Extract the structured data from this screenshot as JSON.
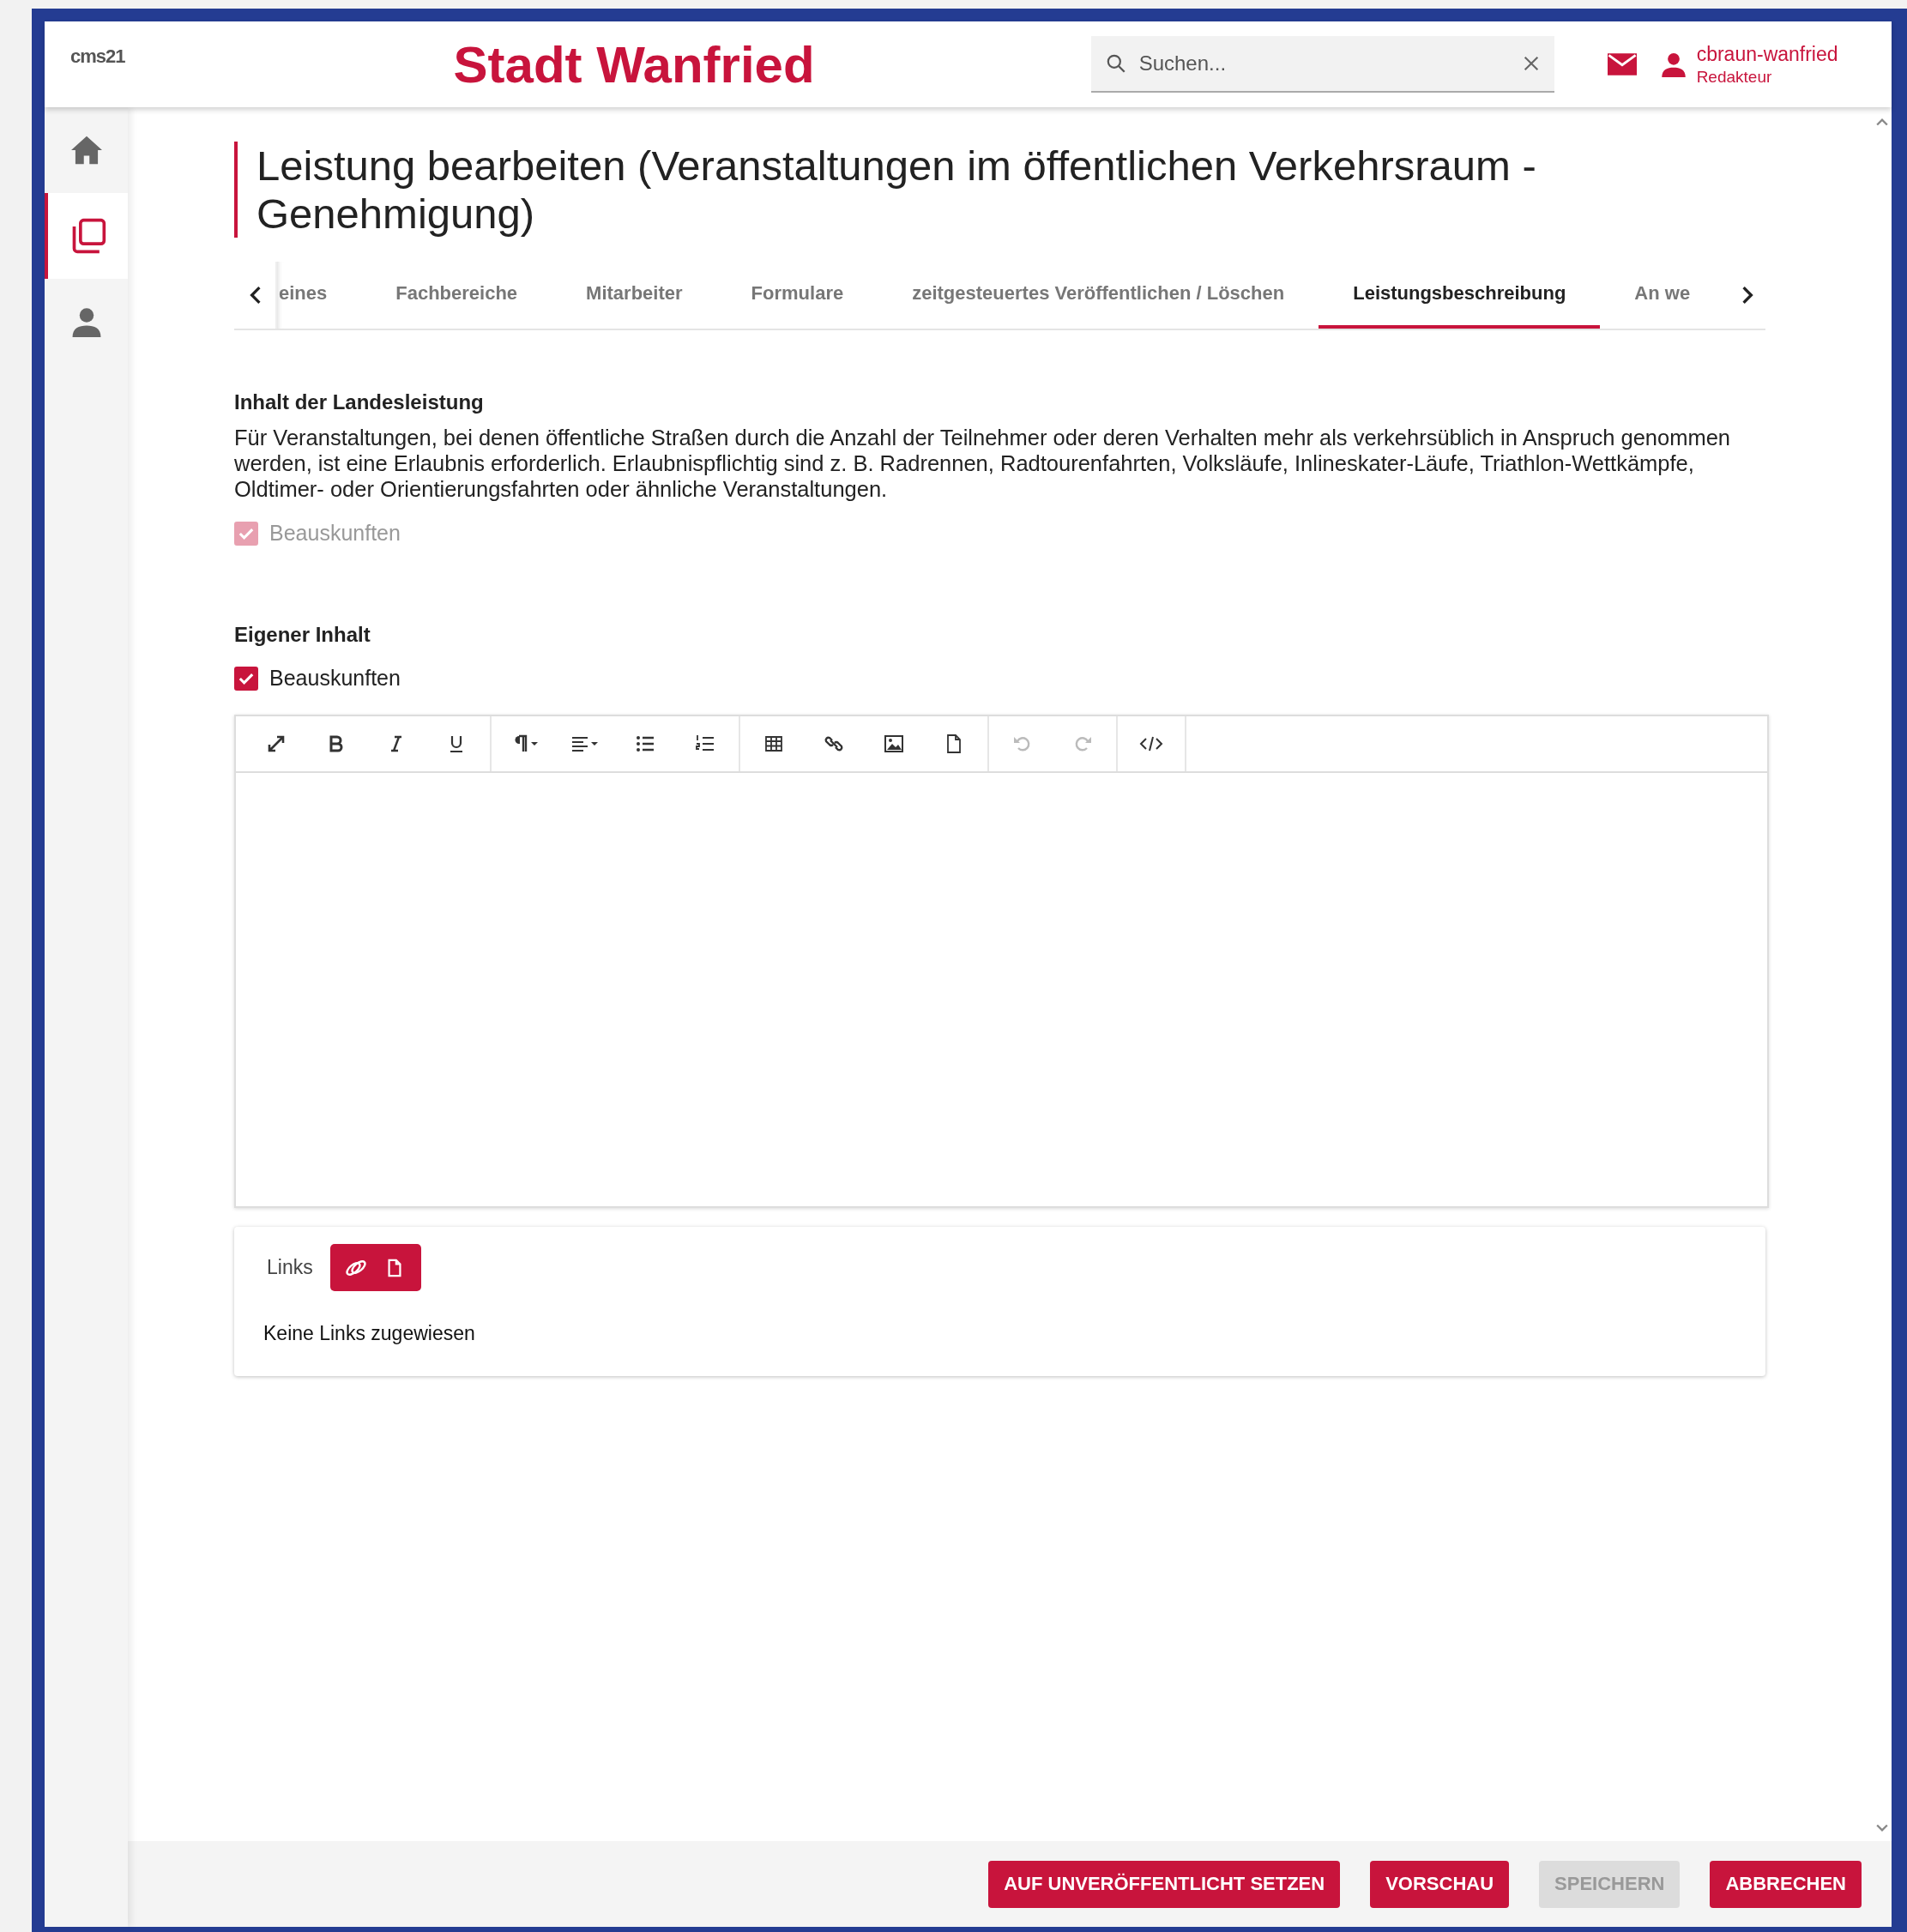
{
  "header": {
    "logo": "cms21",
    "site_title": "Stadt Wanfried",
    "search": {
      "placeholder": "Suchen..."
    },
    "user": {
      "name": "cbraun-wanfried",
      "role": "Redakteur"
    }
  },
  "sidebar": {
    "items": [
      {
        "kind": "home",
        "selected": false
      },
      {
        "kind": "pages",
        "selected": true
      },
      {
        "kind": "person",
        "selected": false
      }
    ]
  },
  "page_title": "Leistung bearbeiten (Veranstaltungen im öffentlichen Verkehrsraum - Genehmigung)",
  "tabs": [
    {
      "label": "eines",
      "selected": false
    },
    {
      "label": "Fachbereiche",
      "selected": false
    },
    {
      "label": "Mitarbeiter",
      "selected": false
    },
    {
      "label": "Formulare",
      "selected": false
    },
    {
      "label": "zeitgesteuertes Veröffentlichen / Löschen",
      "selected": false
    },
    {
      "label": "Leistungsbeschreibung",
      "selected": true
    },
    {
      "label": "An we",
      "selected": false
    }
  ],
  "sections": [
    {
      "heading": "Inhalt der Landesleistung",
      "text": "Für Veranstaltungen, bei denen öffentliche Straßen durch die Anzahl der Teilnehmer oder deren Verhalten mehr als verkehrsüblich in Anspruch genommen werden, ist eine Erlaubnis erforderlich. Erlaubnispflichtig sind z. B. Radrennen, Radtourenfahrten, Volksläufe, Inlineskater-Läufe, Triathlon-Wettkämpfe, Oldtimer- oder Orientierungsfahrten oder ähnliche Veranstaltungen.",
      "checkbox": {
        "label": "Beauskunften",
        "checked": true,
        "disabled": true
      }
    },
    {
      "heading": "Eigener Inhalt",
      "checkbox": {
        "label": "Beauskunften",
        "checked": true,
        "disabled": false
      }
    }
  ],
  "editor": {
    "toolbar": [
      [
        {
          "kind": "fullscreen",
          "disabled": false
        },
        {
          "kind": "bold",
          "disabled": false
        },
        {
          "kind": "italic",
          "disabled": false
        },
        {
          "kind": "underline",
          "disabled": false
        }
      ],
      [
        {
          "kind": "paragraph",
          "disabled": false
        },
        {
          "kind": "align",
          "disabled": false
        },
        {
          "kind": "bullets",
          "disabled": false
        },
        {
          "kind": "numbers",
          "disabled": false
        }
      ],
      [
        {
          "kind": "table",
          "disabled": false
        },
        {
          "kind": "link",
          "disabled": false
        },
        {
          "kind": "image",
          "disabled": false
        },
        {
          "kind": "file",
          "disabled": false
        }
      ],
      [
        {
          "kind": "undo",
          "disabled": true
        },
        {
          "kind": "redo",
          "disabled": true
        }
      ],
      [
        {
          "kind": "code",
          "disabled": false
        }
      ]
    ]
  },
  "links": {
    "label": "Links",
    "buttons": [
      {
        "kind": "link"
      },
      {
        "kind": "file"
      }
    ],
    "empty_text": "Keine Links zugewiesen"
  },
  "footer": {
    "buttons": [
      {
        "label": "AUF UNVERÖFFENTLICHT SETZEN",
        "disabled": false
      },
      {
        "label": "VORSCHAU",
        "disabled": false
      },
      {
        "label": "SPEICHERN",
        "disabled": true
      },
      {
        "label": "ABBRECHEN",
        "disabled": false
      }
    ]
  }
}
